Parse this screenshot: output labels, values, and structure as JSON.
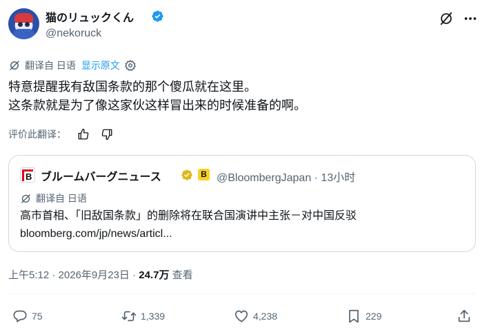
{
  "author": {
    "display_name": "猫のリュックくん",
    "handle": "@nekoruck"
  },
  "translation_bar": {
    "label": "翻译自 日语",
    "show_original": "显示原文"
  },
  "tweet": {
    "line1": "特意提醒我有敌国条款的那个傻瓜就在这里。",
    "line2": "这条款就是为了像这家伙这样冒出来的时候准备的啊。"
  },
  "rate_translation": "评价此翻译：",
  "quote": {
    "name": "ブルームバーグニュース",
    "logo_letter": "B",
    "badge_letter": "B",
    "handle_time": "@BloombergJapan · 13小时",
    "translation_label": "翻译自 日语",
    "text": "高市首相、「旧敌国条款」的删除将在联合国演讲中主张－对中国反驳",
    "link": "bloomberg.com/jp/news/articl..."
  },
  "meta": {
    "time_date": "上午5:12 · 2026年9月23日 · ",
    "views_count": "24.7万",
    "views_label": " 查看"
  },
  "actions": {
    "replies": "75",
    "retweets": "1,339",
    "likes": "4,238",
    "bookmarks": "229"
  },
  "colors": {
    "accent": "#1d9bf0",
    "muted": "#536471",
    "text": "#0f1419",
    "border": "#cfd9de",
    "gold_badge": "#e2b719",
    "bloomberg_red": "#e0001b"
  },
  "icons": [
    "avatar",
    "verified-badge-icon",
    "grok-icon",
    "more-icon",
    "translate-icon",
    "gear-icon",
    "thumbs-up-icon",
    "thumbs-down-icon",
    "reply-icon",
    "retweet-icon",
    "like-icon",
    "bookmark-icon",
    "share-icon"
  ]
}
